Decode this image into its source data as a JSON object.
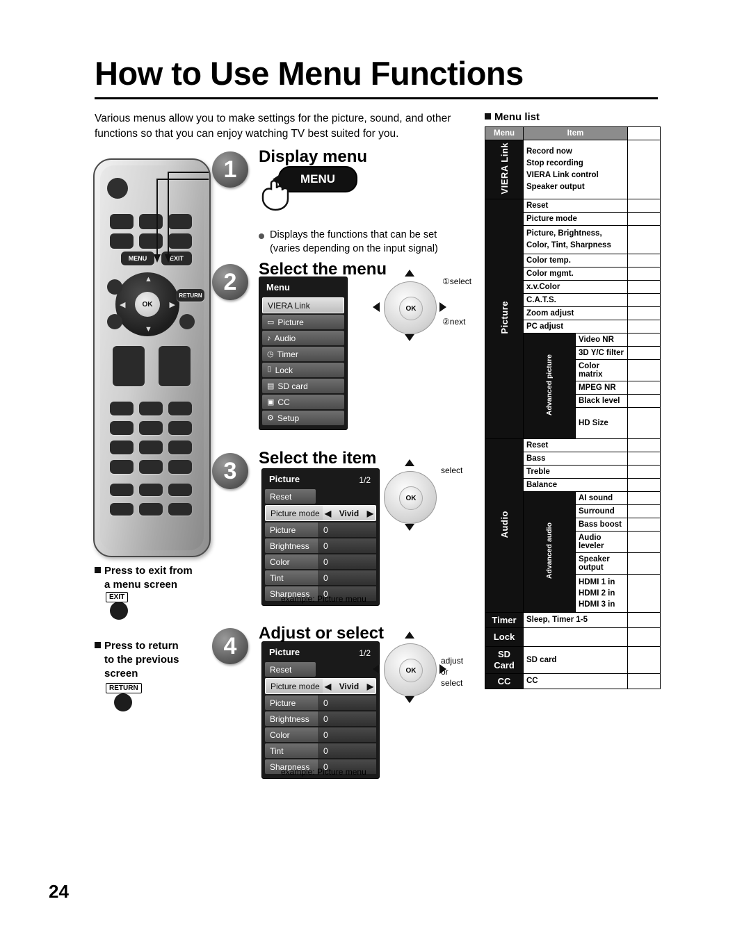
{
  "page": {
    "title": "How to Use Menu Functions",
    "number": "24",
    "intro": "Various menus allow you to make settings for the picture, sound, and other functions so that you can enjoy watching TV best suited for you."
  },
  "steps": {
    "step1": {
      "num": "1",
      "title": "Display menu",
      "button_label": "MENU",
      "note_line1": "Displays the functions that can be set",
      "note_line2": "(varies depending on the input signal)"
    },
    "step2": {
      "num": "2",
      "title": "Select the menu",
      "osd_title": "Menu",
      "rows": [
        {
          "label": "VIERA Link",
          "icon": "",
          "selected": true
        },
        {
          "label": "Picture",
          "icon": "picture-icon",
          "glyph": "▭",
          "selected": false
        },
        {
          "label": "Audio",
          "icon": "audio-icon",
          "glyph": "♪",
          "selected": false
        },
        {
          "label": "Timer",
          "icon": "timer-icon",
          "glyph": "◷",
          "selected": false
        },
        {
          "label": "Lock",
          "icon": "lock-icon",
          "glyph": "🔒",
          "selected": false
        },
        {
          "label": "SD card",
          "icon": "sdcard-icon",
          "glyph": "▤",
          "selected": false
        },
        {
          "label": "CC",
          "icon": "cc-icon",
          "glyph": "▣",
          "selected": false
        },
        {
          "label": "Setup",
          "icon": "setup-icon",
          "glyph": "⚙",
          "selected": false
        }
      ],
      "hint_select": "select",
      "hint_select_num": "①",
      "hint_next": "next",
      "hint_next_num": "②"
    },
    "step3": {
      "num": "3",
      "title": "Select the item",
      "osd_title": "Picture",
      "osd_page": "1/2",
      "hint": "select",
      "caption_label": "example:",
      "caption_text": "Picture menu",
      "rows": [
        {
          "label": "Reset",
          "value": "",
          "type": "reset"
        },
        {
          "label": "Picture mode",
          "value": "Vivid",
          "type": "selected"
        },
        {
          "label": "Picture",
          "value": "0",
          "type": "normal"
        },
        {
          "label": "Brightness",
          "value": "0",
          "type": "normal"
        },
        {
          "label": "Color",
          "value": "0",
          "type": "normal"
        },
        {
          "label": "Tint",
          "value": "0",
          "type": "normal"
        },
        {
          "label": "Sharpness",
          "value": "0",
          "type": "normal"
        }
      ]
    },
    "step4": {
      "num": "4",
      "title": "Adjust or select",
      "osd_title": "Picture",
      "osd_page": "1/2",
      "hint_line1": "adjust",
      "hint_line2": "or",
      "hint_line3": "select",
      "caption_label": "example:",
      "caption_text": "Picture menu",
      "rows": [
        {
          "label": "Reset",
          "value": "",
          "type": "reset"
        },
        {
          "label": "Picture mode",
          "value": "Vivid",
          "type": "selected"
        },
        {
          "label": "Picture",
          "value": "0",
          "type": "normal"
        },
        {
          "label": "Brightness",
          "value": "0",
          "type": "normal"
        },
        {
          "label": "Color",
          "value": "0",
          "type": "normal"
        },
        {
          "label": "Tint",
          "value": "0",
          "type": "normal"
        },
        {
          "label": "Sharpness",
          "value": "0",
          "type": "normal"
        }
      ]
    }
  },
  "notes": {
    "exit": {
      "line1": "Press to exit from",
      "line2": "a menu screen",
      "key": "EXIT"
    },
    "return": {
      "line1": "Press to return",
      "line2": "to the previous",
      "line3": "screen",
      "key": "RETURN"
    }
  },
  "remote": {
    "menu_key": "MENU",
    "exit_key": "EXIT",
    "ok_key": "OK",
    "return_key": "RETURN"
  },
  "menu_list": {
    "heading": "Menu list",
    "col_menu": "Menu",
    "col_item": "Item",
    "groups": [
      {
        "category": "VIERA Link",
        "rows": [
          {
            "item": "Record now\nStop recording\nVIERA Link control\nSpeaker output",
            "multiline": true
          }
        ]
      },
      {
        "category": "Picture",
        "rows": [
          {
            "item": "Reset"
          },
          {
            "item": "Picture mode"
          },
          {
            "item": "Picture, Brightness,\nColor, Tint, Sharpness",
            "multiline": true
          },
          {
            "item": "Color temp."
          },
          {
            "item": "Color mgmt."
          },
          {
            "item": "x.v.Color"
          },
          {
            "item": "C.A.T.S."
          },
          {
            "item": "Zoom adjust"
          },
          {
            "item": "PC adjust"
          }
        ],
        "sub": {
          "label": "Advanced picture",
          "rows": [
            "Video NR",
            "3D Y/C filter",
            "Color matrix",
            "MPEG NR",
            "Black level",
            "HD Size"
          ]
        }
      },
      {
        "category": "Audio",
        "rows": [
          {
            "item": "Reset"
          },
          {
            "item": "Bass"
          },
          {
            "item": "Treble"
          },
          {
            "item": "Balance"
          }
        ],
        "sub": {
          "label": "Advanced audio",
          "rows": [
            "AI sound",
            "Surround",
            "Bass boost",
            "Audio leveler",
            "Speaker output",
            "HDMI 1 in\nHDMI 2 in\nHDMI 3 in"
          ]
        }
      },
      {
        "category": "Timer",
        "rows": [
          {
            "item": "Sleep, Timer 1-5"
          }
        ]
      },
      {
        "category": "Lock",
        "rows": [
          {
            "item": ""
          }
        ]
      },
      {
        "category": "SD Card",
        "rows": [
          {
            "item": "SD card"
          }
        ]
      },
      {
        "category": "CC",
        "rows": [
          {
            "item": "CC"
          }
        ]
      }
    ]
  }
}
